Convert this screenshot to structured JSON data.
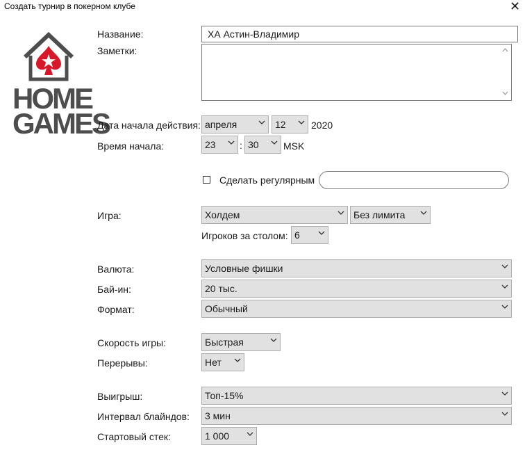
{
  "window": {
    "title": "Создать турнир в покерном клубе",
    "close_glyph": "✕"
  },
  "logo": {
    "line1": "HOME",
    "line2": "GAMES",
    "icon": "house-spade-logo"
  },
  "form": {
    "name_label": "Название:",
    "name_value": "ХА Астин-Владимир",
    "notes_label": "Заметки:",
    "notes_value": "",
    "start_date_label": "Дата начала действия:",
    "month_value": "апреля",
    "day_value": "12",
    "year_value": "2020",
    "start_time_label": "Время начала:",
    "hour_value": "23",
    "time_sep": ":",
    "minute_value": "30",
    "timezone": "MSK",
    "recurring_label": "Сделать регулярным",
    "recurring_value": "",
    "game_label": "Игра:",
    "game_value": "Холдем",
    "limit_value": "Без лимита",
    "players_label": "Игроков за столом:",
    "players_value": "6",
    "currency_label": "Валюта:",
    "currency_value": "Условные фишки",
    "buyin_label": "Бай-ин:",
    "buyin_value": "20 тыс.",
    "format_label": "Формат:",
    "format_value": "Обычный",
    "speed_label": "Скорость игры:",
    "speed_value": "Быстрая",
    "breaks_label": "Перерывы:",
    "breaks_value": "Нет",
    "payout_label": "Выигрыш:",
    "payout_value": "Топ-15%",
    "blind_interval_label": "Интервал блайндов:",
    "blind_interval_value": "3 мин",
    "starting_stack_label": "Стартовый стек:",
    "starting_stack_value": "1 000"
  },
  "colors": {
    "logo_red": "#d7182a",
    "logo_gray": "#4d4d4d",
    "control_bg": "#e1e1e1"
  }
}
